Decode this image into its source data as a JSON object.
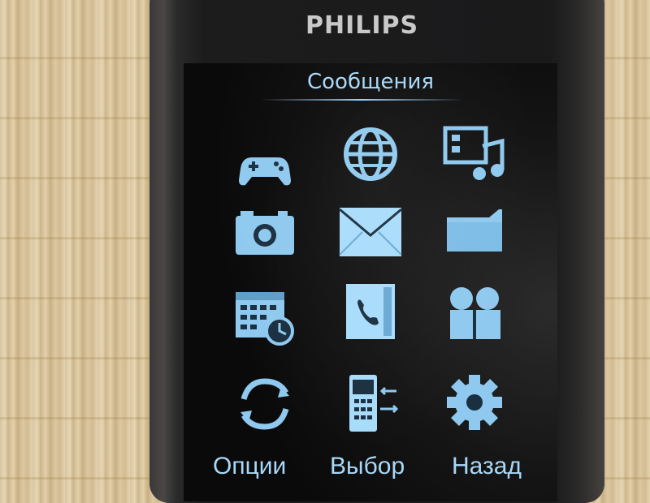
{
  "device": {
    "brand": "PHILIPS"
  },
  "screen": {
    "title": "Сообщения",
    "icons": [
      {
        "name": "games-icon"
      },
      {
        "name": "browser-icon"
      },
      {
        "name": "multimedia-icon"
      },
      {
        "name": "camera-icon"
      },
      {
        "name": "messages-icon"
      },
      {
        "name": "folder-icon"
      },
      {
        "name": "organizer-icon"
      },
      {
        "name": "call-log-icon"
      },
      {
        "name": "contacts-icon"
      },
      {
        "name": "sync-icon"
      },
      {
        "name": "connectivity-icon"
      },
      {
        "name": "settings-icon"
      }
    ],
    "accent_color": "#a8d8f8"
  },
  "softkeys": {
    "left": "Опции",
    "center": "Выбор",
    "right": "Назад"
  }
}
